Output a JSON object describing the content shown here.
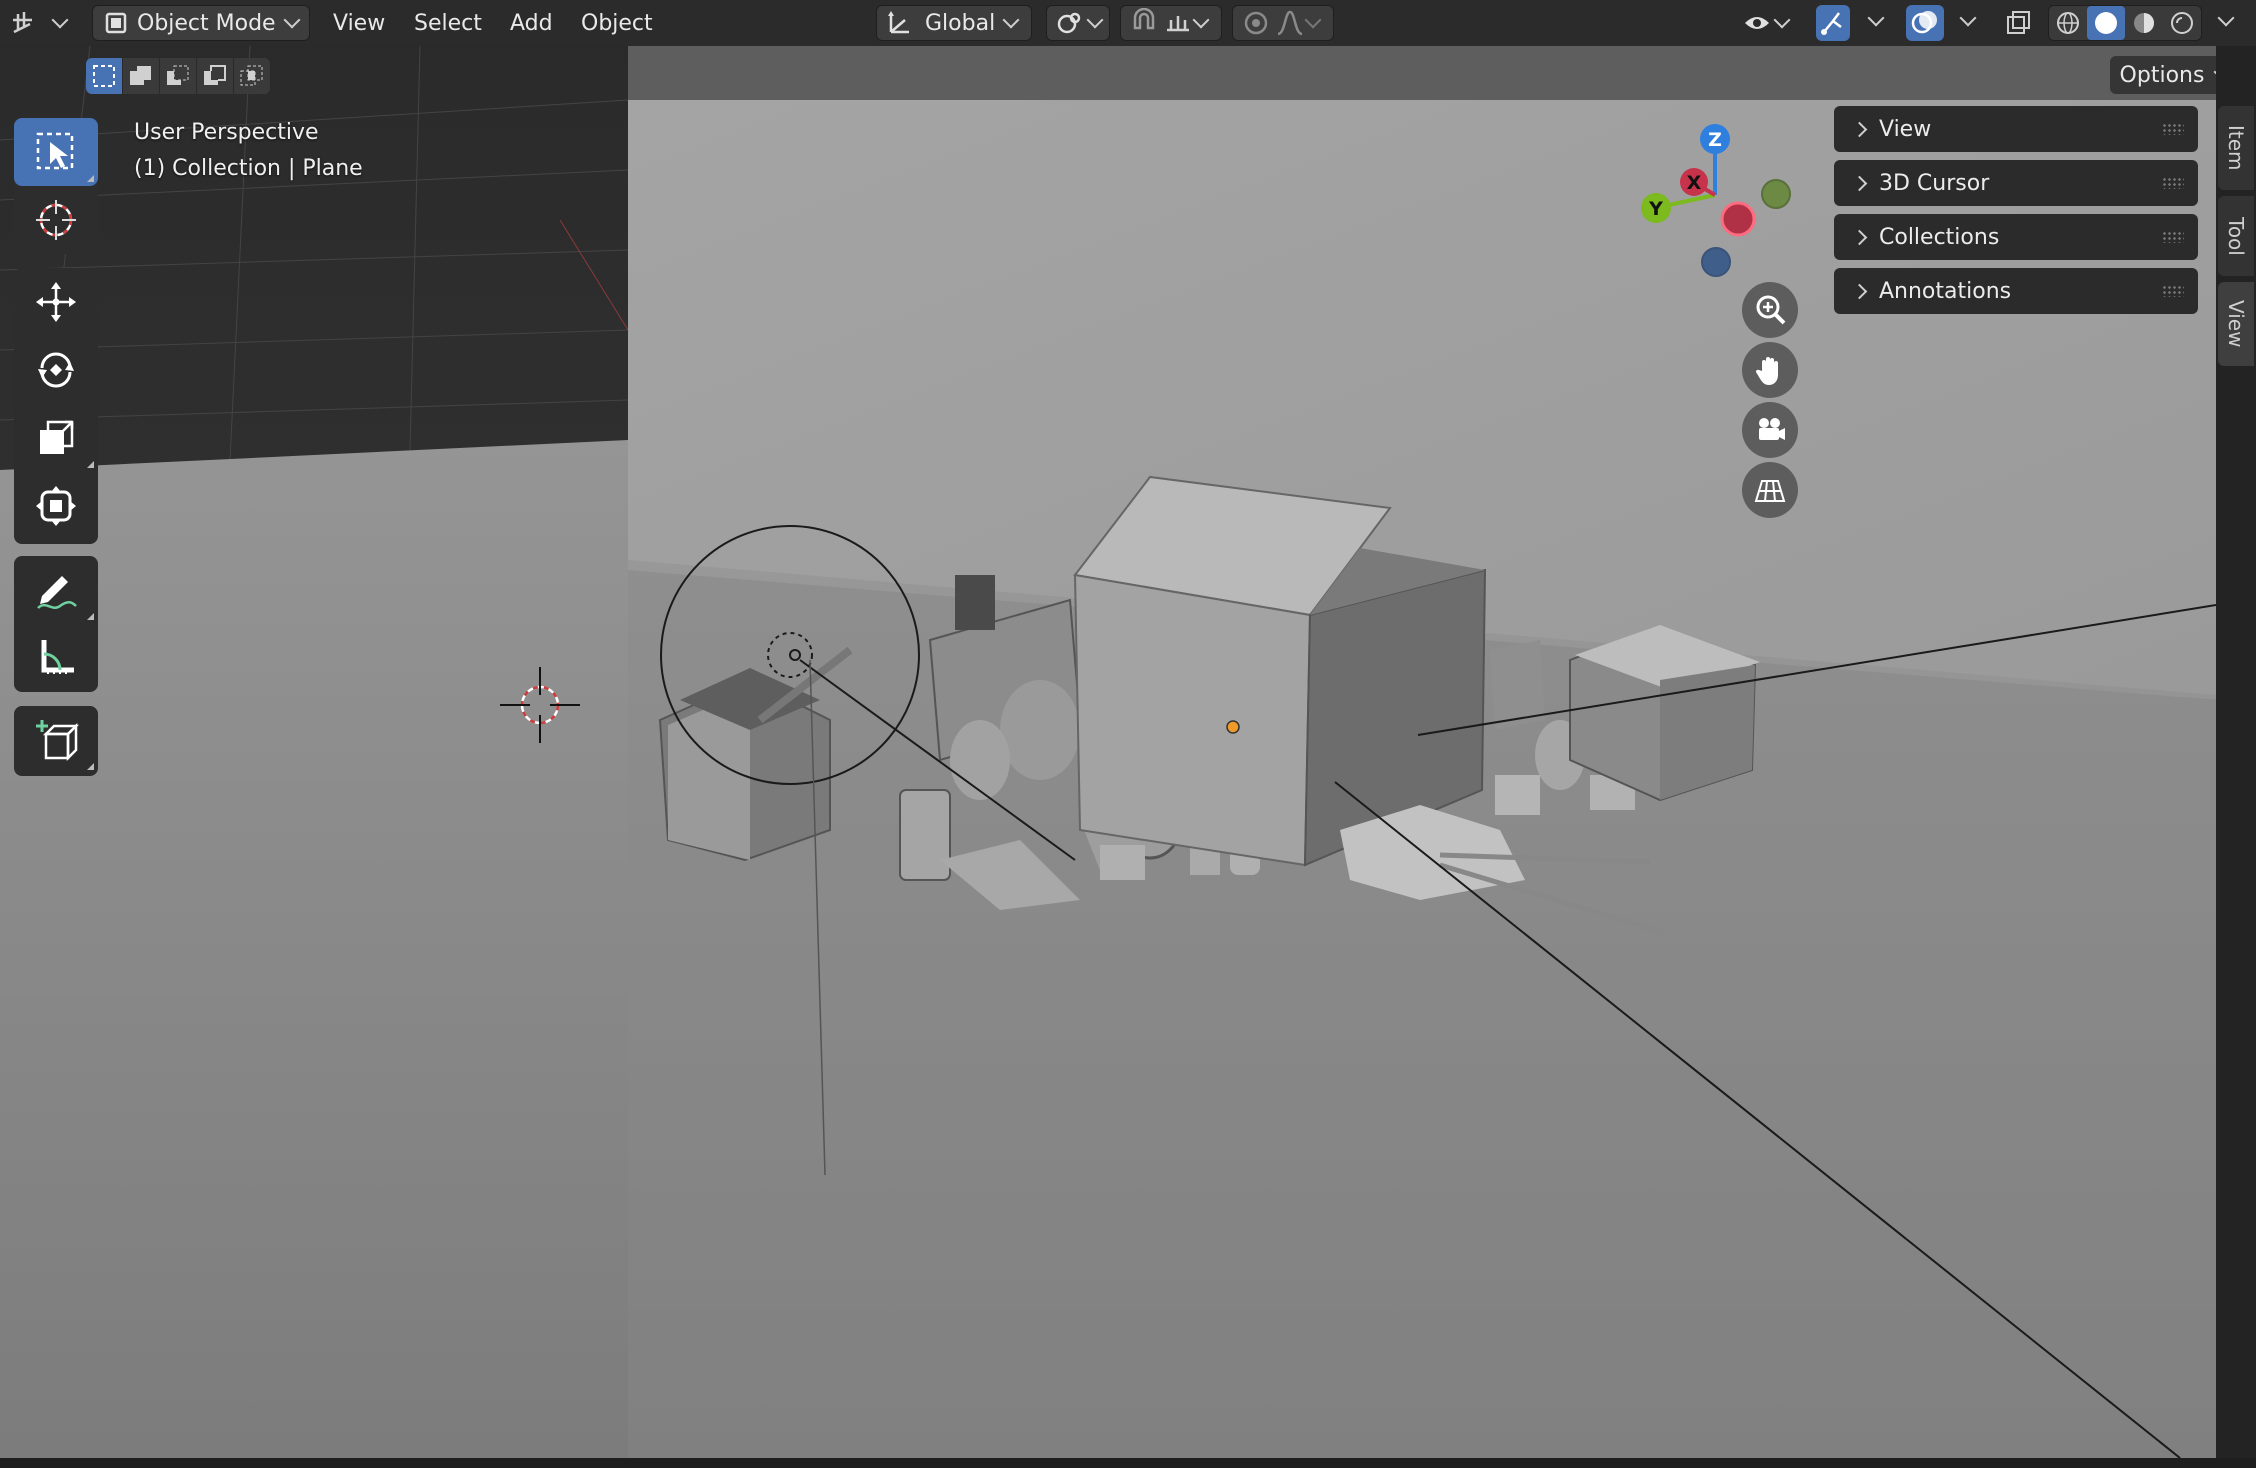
{
  "header": {
    "editor_type_icon": "editor-type-3d-viewport-icon",
    "mode": "Object Mode",
    "menus": [
      "View",
      "Select",
      "Add",
      "Object"
    ],
    "transform_orientation": "Global",
    "pivot_icon": "pivot-point-icon",
    "snap_icon": "magnet-snap-icon",
    "snap_increment_icon": "snap-increment-icon",
    "proportional_icon": "proportional-editing-icon",
    "falloff_icon": "falloff-curve-icon",
    "visibility_icon": "eye-visibility-icon",
    "gizmo_icon": "gizmo-toggle-icon",
    "overlay_icon": "overlay-toggle-icon",
    "xray_icon": "xray-toggle-icon",
    "shading_modes": [
      "wireframe",
      "solid",
      "material-preview",
      "rendered"
    ],
    "shading_active": "solid"
  },
  "selection_modes": [
    "new",
    "extend",
    "subtract",
    "difference",
    "intersect"
  ],
  "viewport": {
    "perspective_label": "User Perspective",
    "collection_label": "(1) Collection | Plane",
    "options_label": "Options"
  },
  "navigation_gizmo": {
    "axes": [
      "Z",
      "X",
      "Y"
    ]
  },
  "nav_buttons": [
    "zoom-icon",
    "hand-pan-icon",
    "camera-view-icon",
    "ortho-grid-icon"
  ],
  "toolbar": {
    "tools": [
      "select-box",
      "cursor",
      "move",
      "rotate",
      "scale",
      "transform",
      "annotate",
      "measure",
      "add-cube"
    ],
    "active": "select-box"
  },
  "sidebar": {
    "panels": [
      {
        "label": "View"
      },
      {
        "label": "3D Cursor"
      },
      {
        "label": "Collections"
      },
      {
        "label": "Annotations"
      }
    ],
    "tabs": [
      {
        "label": "Item"
      },
      {
        "label": "Tool"
      },
      {
        "label": "View"
      }
    ],
    "active_tab": "View"
  },
  "colors": {
    "accent": "#4772b3",
    "header_bg": "#2b2b2b",
    "viewport_floor": "#7f7f7f",
    "axis_x": "#c7334b",
    "axis_y": "#7cba1e",
    "axis_z": "#2e7fde",
    "origin_dot": "#f09a2a"
  }
}
